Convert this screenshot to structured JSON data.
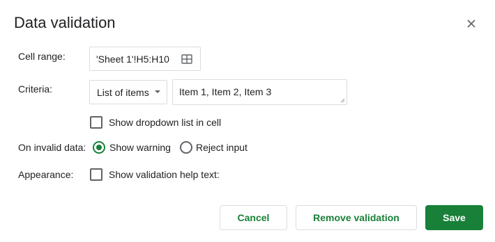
{
  "dialog": {
    "title": "Data validation",
    "close_icon": "close-icon"
  },
  "cell_range": {
    "label": "Cell range:",
    "value": "'Sheet 1'!H5:H10",
    "icon": "grid-icon"
  },
  "criteria": {
    "label": "Criteria:",
    "selected": "List of items",
    "items_value": "Item 1, Item 2, Item 3"
  },
  "dropdown_option": {
    "label": "Show dropdown list in cell",
    "checked": false
  },
  "invalid_data": {
    "label": "On invalid data:",
    "show_warning": "Show warning",
    "reject_input": "Reject input",
    "selected": "Show warning"
  },
  "appearance": {
    "label": "Appearance:",
    "help_text_label": "Show validation help text:",
    "checked": false
  },
  "buttons": {
    "cancel": "Cancel",
    "remove": "Remove validation",
    "save": "Save"
  },
  "colors": {
    "accent": "#188038",
    "border": "#dadce0",
    "text": "#202124"
  }
}
